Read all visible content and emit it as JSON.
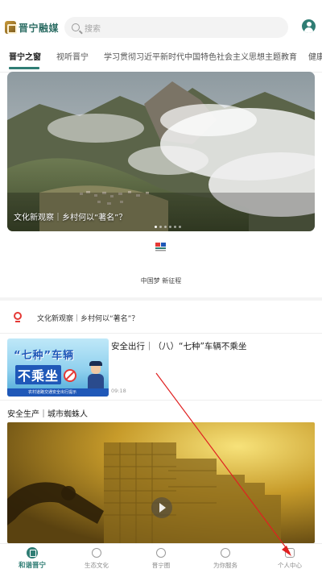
{
  "header": {
    "logo_text": "晋宁融媒",
    "search_placeholder": "搜索"
  },
  "tabs": [
    {
      "label": "晋宁之窗",
      "active": true
    },
    {
      "label": "视听晋宁",
      "active": false
    },
    {
      "label": "学习贯彻习近平新时代中国特色社会主义思想主题教育",
      "active": false
    },
    {
      "label": "健康",
      "active": false
    }
  ],
  "banner": {
    "caption": "文化新观察｜乡村何以“著名”？",
    "page_count": 6,
    "active_page": 1
  },
  "promo": {
    "label": "中国梦 新征程"
  },
  "headline": {
    "text": "文化新观察｜乡村何以“著名”？"
  },
  "news_item": {
    "title": "安全出行｜（八）“七种”车辆不乘坐",
    "time": "09:18",
    "thumb_title": "“七种”车辆",
    "thumb_big": "不乘坐",
    "thumb_bottom": "农村道路交通安全出行提示"
  },
  "video_item": {
    "title": "安全生产｜城市蜘蛛人"
  },
  "bottom_nav": [
    {
      "label": "和谐晋宁",
      "icon": "home-icon",
      "active": true
    },
    {
      "label": "生态文化",
      "icon": "leaf-icon",
      "active": false
    },
    {
      "label": "晋宁圈",
      "icon": "circle-icon",
      "active": false
    },
    {
      "label": "为你服务",
      "icon": "service-icon",
      "active": false
    },
    {
      "label": "个人中心",
      "icon": "profile-icon",
      "active": false
    }
  ],
  "colors": {
    "brand": "#2f7d74",
    "accent_red": "#e53935",
    "annotation_arrow": "#e02020"
  }
}
